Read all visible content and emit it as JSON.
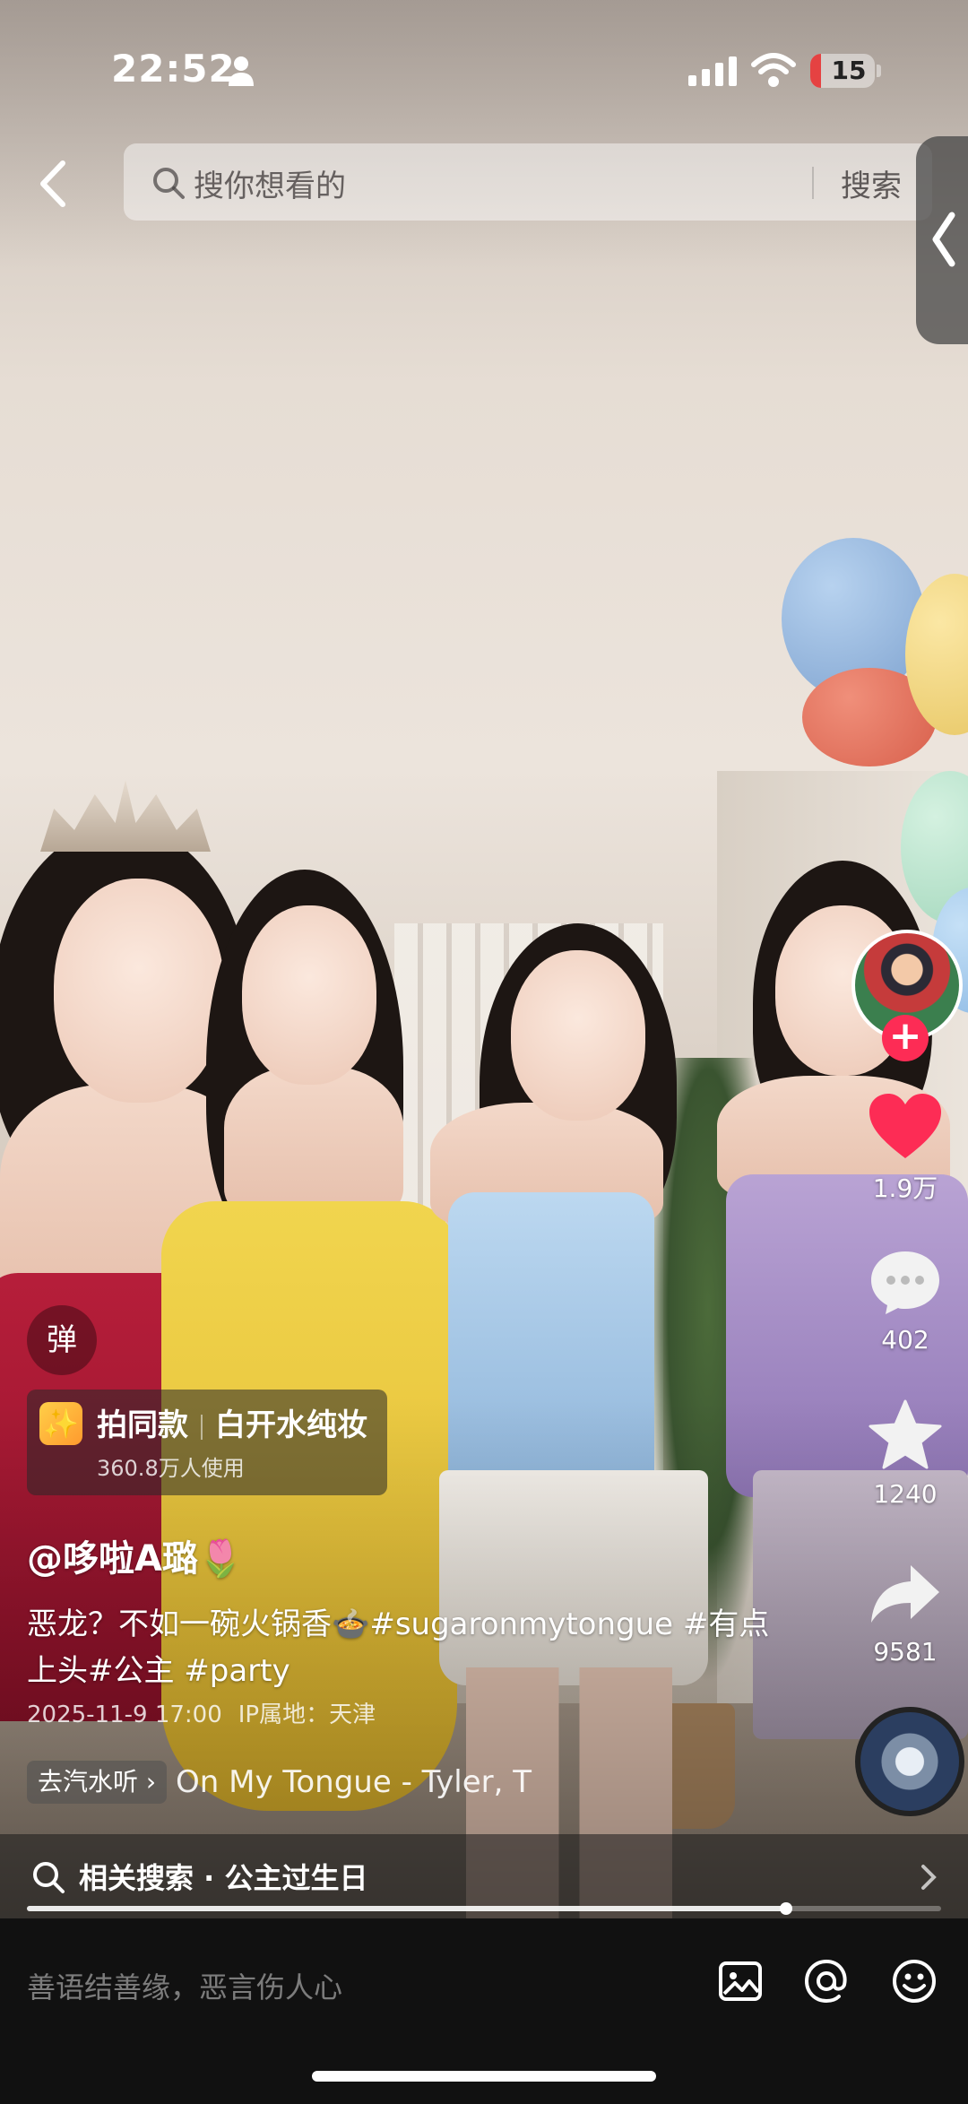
{
  "status_bar": {
    "time": "22:52",
    "battery": "15"
  },
  "search": {
    "placeholder": "搜你想看的",
    "button": "搜索"
  },
  "actions": {
    "likes": "1.9万",
    "comments": "402",
    "favorites": "1240",
    "shares": "9581"
  },
  "overlay": {
    "danmu": "弹",
    "effect": {
      "icon": "✨",
      "label": "拍同款",
      "name": "白开水纯妆",
      "usage": "360.8万人使用"
    },
    "author": "@哆啦A璐🌷",
    "caption": "恶龙？不如一碗火锅香🍲#sugaronmytongue #有点上头#公主 #party",
    "date": "2025-11-9 17:00",
    "ip": "IP属地：天津",
    "listen_tag": "去汽水听 ›",
    "music": "On My Tongue - Tyler, T"
  },
  "related": {
    "text": "相关搜索 · 公主过生日"
  },
  "progress": 0.83,
  "comment": {
    "placeholder": "善语结善缘，恶言伤人心"
  },
  "icons": [
    "back-icon",
    "search-icon",
    "heart-icon",
    "comment-icon",
    "star-icon",
    "share-icon",
    "image-icon",
    "at-icon",
    "emoji-icon"
  ]
}
